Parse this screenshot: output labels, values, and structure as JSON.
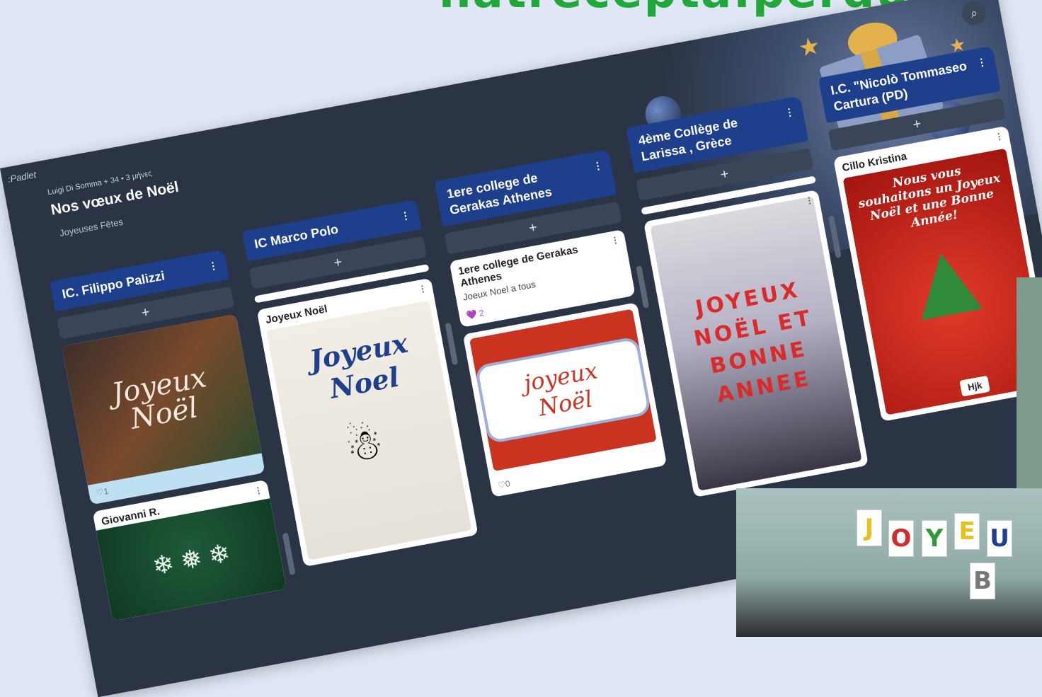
{
  "banner_text": "natrecepta:perdu:p",
  "app": {
    "logo": ":Padlet"
  },
  "header": {
    "meta": "Luigi Di Somma + 34 • 3 μήνες",
    "title": "Nos vœux de Noël",
    "subtitle": "Joyeuses Fêtes"
  },
  "columns": [
    {
      "title": "IC. Filippo Palizzi",
      "add": "+",
      "cards": [
        {
          "image_text": "Joyeux Noël",
          "likes": "♡1"
        },
        {
          "title": "Giovanni R."
        }
      ]
    },
    {
      "title": "IC Marco Polo",
      "add": "+",
      "cards": [
        {
          "title": "Joyeux Noël",
          "image_text": "Joyeux Noel"
        }
      ]
    },
    {
      "title": "1ere college de Gerakas Athenes",
      "add": "+",
      "cards": [
        {
          "title": "1ere college de Gerakas Athenes",
          "text": "Joeux Noel a tous",
          "likes": "💜 2"
        },
        {
          "image_text": "joyeux Noël",
          "likes": "♡0"
        }
      ]
    },
    {
      "title": "4ème Collège de Larissa , Grèce",
      "add": "+",
      "cards": [
        {
          "image_text": "JOYEUX NOËL ET BONNE ANNEE"
        }
      ]
    },
    {
      "title": "I.C. \"Nicolò Tommaseo Cartura (PD)",
      "add": "+",
      "cards": [
        {
          "title": "Cillo Kristina",
          "image_text": "Nous vous souhaitons un Joyeux Noël et une Bonne Année!",
          "caption": "Hjk"
        }
      ]
    }
  ],
  "photo_letters": [
    "J",
    "O",
    "Y",
    "E",
    "U",
    "B"
  ],
  "colors": {
    "board": "#2b3444",
    "column_header": "#1e3f8c",
    "banner": "#22a83a"
  }
}
